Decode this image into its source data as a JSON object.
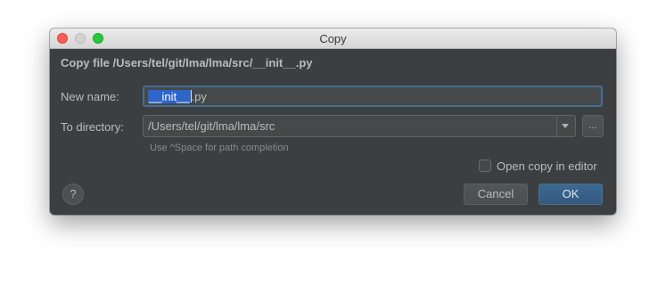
{
  "window": {
    "title": "Copy"
  },
  "dialog": {
    "header": "Copy file /Users/tel/git/lma/lma/src/__init__.py",
    "new_name": {
      "label": "New name:",
      "selected_text": "__init__",
      "rest_text": ".py"
    },
    "to_directory": {
      "label": "To directory:",
      "value": "/Users/tel/git/lma/lma/src",
      "browse_label": "...",
      "hint": "Use ^Space for path completion"
    },
    "open_copy_in_editor": {
      "label": "Open copy in editor",
      "checked": false
    },
    "help_label": "?",
    "cancel_label": "Cancel",
    "ok_label": "OK"
  },
  "icons": {
    "close": "close-traffic-light",
    "minimize": "minimize-traffic-light",
    "zoom": "zoom-traffic-light",
    "dropdown": "chevron-down-icon",
    "help": "question-mark-icon"
  },
  "colors": {
    "dialog_background": "#3c3f41",
    "text": "#bbbbbb",
    "selection": "#2f65ca",
    "focus_border": "#466d94",
    "ok_button": "#365880",
    "close_light": "#fc5f57",
    "zoom_light": "#2bc63f"
  }
}
